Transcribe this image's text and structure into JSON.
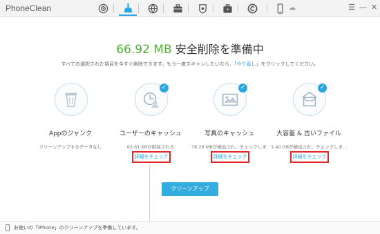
{
  "app": {
    "title": "PhoneClean"
  },
  "toolbar": {
    "items": [
      {
        "icon": "dashboard-icon",
        "active": false
      },
      {
        "icon": "broom-clean-icon",
        "active": true
      },
      {
        "icon": "globe-icon",
        "active": false
      },
      {
        "icon": "toolbox-icon",
        "active": false
      },
      {
        "icon": "shield-icon",
        "active": false
      },
      {
        "icon": "briefcase-icon",
        "active": false
      },
      {
        "icon": "copyright-icon",
        "active": false
      },
      {
        "icon": "phone-icon",
        "active": false
      }
    ],
    "window_controls": {
      "menu": "☰",
      "minimize": "—",
      "close": "✕"
    }
  },
  "headline": {
    "amount": "66.92 MB",
    "text": "安全削除を準備中"
  },
  "subline": {
    "prefix": "すべての選択された項目を今すぐ削除できます。もう一度スキャンしたいなら、「",
    "link": "やり直し",
    "suffix": "」をクリックしてください。"
  },
  "cards": [
    {
      "icon": "trash-can-icon",
      "checked": false,
      "name": "Appのジャンク",
      "desc": "クリーンアップするデータなし",
      "link": ""
    },
    {
      "icon": "user-cache-icon",
      "checked": true,
      "name": "ユーザーのキャッシュ",
      "desc": "63.61 KBが削除される",
      "link": "詳細をチェック"
    },
    {
      "icon": "photo-icon",
      "checked": true,
      "name": "写真のキャッシュ",
      "desc": "78.29 MBが検出され、チェックしま...",
      "link": "詳細をチェック"
    },
    {
      "icon": "large-file-box-icon",
      "checked": true,
      "name": "大容量 & 古いファイル",
      "desc": "1.40 GBが検出され、チェックしま...",
      "link": "詳細をチェック"
    }
  ],
  "cleanup_button": "クリーンアップ",
  "status": {
    "text": "お使いの「iPhone」のクリーンアップを準備しています。"
  },
  "colors": {
    "accent": "#2ba6e1",
    "amount_green": "#4caf2f",
    "highlight_red": "#e02626"
  }
}
